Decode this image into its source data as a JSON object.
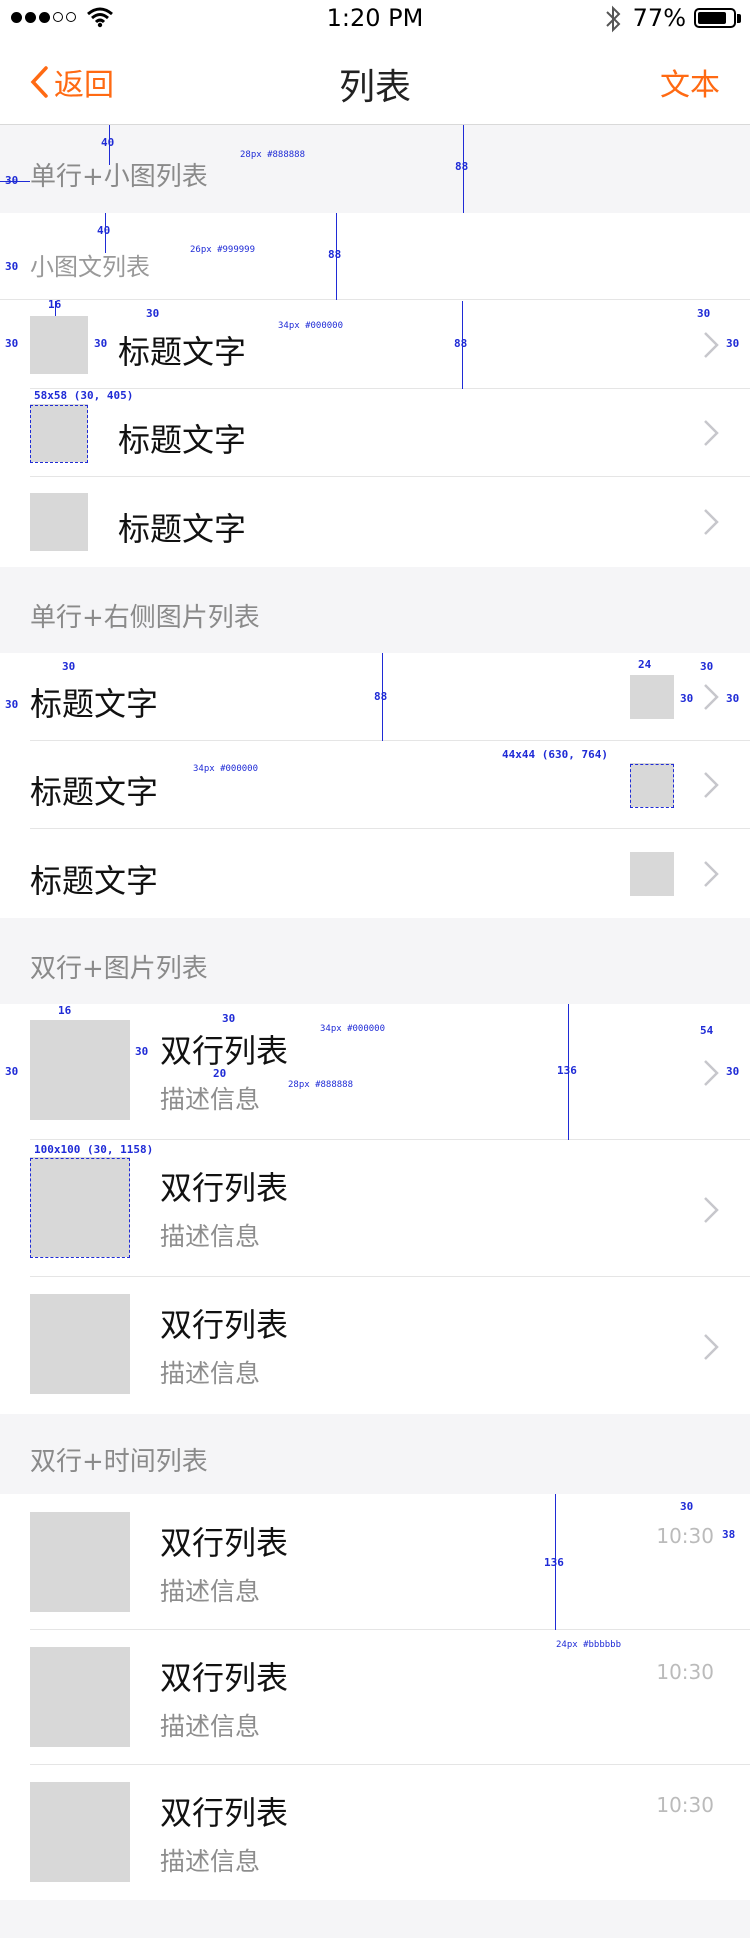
{
  "status_bar": {
    "time": "1:20 PM",
    "battery": "77%"
  },
  "nav": {
    "back_label": "返回",
    "title": "列表",
    "right_label": "文本"
  },
  "section1": {
    "header": "单行+小图列表",
    "subheader": "小图文列表",
    "items": [
      {
        "title": "标题文字"
      },
      {
        "title": "标题文字"
      },
      {
        "title": "标题文字"
      }
    ]
  },
  "section2": {
    "header": "单行+右侧图片列表",
    "items": [
      {
        "title": "标题文字"
      },
      {
        "title": "标题文字"
      },
      {
        "title": "标题文字"
      }
    ]
  },
  "section3": {
    "header": "双行+图片列表",
    "items": [
      {
        "title": "双行列表",
        "desc": "描述信息"
      },
      {
        "title": "双行列表",
        "desc": "描述信息"
      },
      {
        "title": "双行列表",
        "desc": "描述信息"
      }
    ]
  },
  "section4": {
    "header": "双行+时间列表",
    "items": [
      {
        "title": "双行列表",
        "desc": "描述信息",
        "time": "10:30"
      },
      {
        "title": "双行列表",
        "desc": "描述信息",
        "time": "10:30"
      },
      {
        "title": "双行列表",
        "desc": "描述信息",
        "time": "10:30"
      }
    ]
  },
  "annotations": {
    "n40a": "40",
    "n30a": "30",
    "n88a": "88",
    "h1spec": "28px #888888",
    "n40b": "40",
    "n30b": "30",
    "n88b": "88",
    "h2spec": "26px #999999",
    "n16a": "16",
    "n30c": "30",
    "n30d": "30",
    "n30e": "30",
    "n88c": "88",
    "n30f": "30",
    "n30g": "30",
    "t1spec": "34px #000000",
    "size1": "58x58 (30, 405)",
    "n30h": "30",
    "n30i": "30",
    "n88d": "88",
    "n24": "24",
    "n30j": "30",
    "n30k": "30",
    "n30l": "30",
    "t2spec": "34px #000000",
    "size2": "44x44 (630, 764)",
    "n16b": "16",
    "n30m": "30",
    "n30n": "30",
    "n30o": "30",
    "n20": "20",
    "n136a": "136",
    "n54": "54",
    "n30p": "30",
    "t3spec": "34px #000000",
    "d3spec": "28px #888888",
    "size3": "100x100 (30, 1158)",
    "n30q": "30",
    "n38": "38",
    "n136b": "136",
    "timespec": "24px #bbbbbb"
  },
  "colors": {
    "accent": "#ff6a13",
    "header_bg": "#f5f5f7",
    "thumb": "#d8d8d8",
    "annotation": "#1f2bd6"
  }
}
